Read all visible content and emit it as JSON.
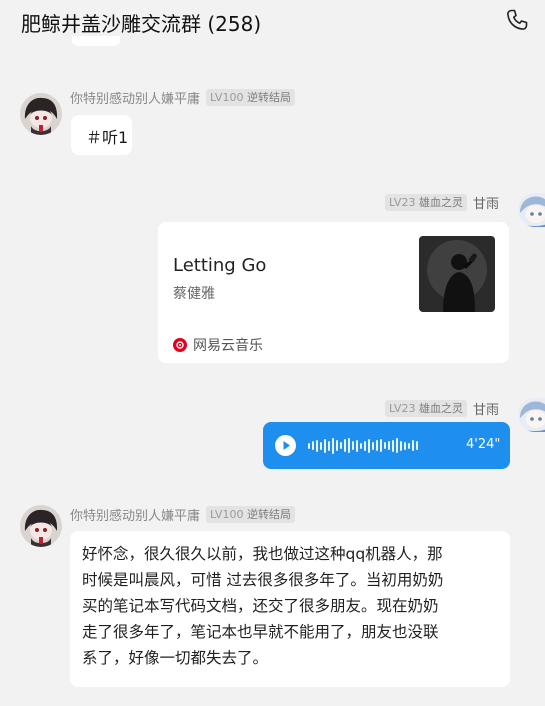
{
  "header": {
    "title": "肥鲸井盖沙雕交流群 (258)",
    "call_icon": "phone-icon"
  },
  "messages": [
    {
      "sender": "你特别感动别人嫌平庸",
      "level": "LV100",
      "title_badge": "逆转结局",
      "text": "＃听1"
    },
    {
      "sender": "甘雨",
      "level": "LV23",
      "title_badge": "雄血之灵",
      "music_card": {
        "song": "Letting Go",
        "artist": "蔡健雅",
        "source": "网易云音乐",
        "source_icon": "netease-music-icon"
      }
    },
    {
      "sender": "甘雨",
      "level": "LV23",
      "title_badge": "雄血之灵",
      "voice": {
        "duration": "4'24\"",
        "play_icon": "play-icon"
      }
    },
    {
      "sender": "你特别感动别人嫌平庸",
      "level": "LV100",
      "title_badge": "逆转结局",
      "lines": [
        "好怀念，很久很久以前，我也做过这种qq机器人，那",
        "时候是叫晨风，可惜 过去很多很多年了。当初用奶奶",
        "买的笔记本写代码文档，还交了很多朋友。现在奶奶",
        "走了很多年了，笔记本也早就不能用了，朋友也没联",
        "系了，好像一切都失去了。"
      ]
    }
  ],
  "colors": {
    "background": "#f2f2f2",
    "bubble": "#ffffff",
    "voice_bubble": "#1f8fef",
    "netease_red": "#e6001f"
  }
}
